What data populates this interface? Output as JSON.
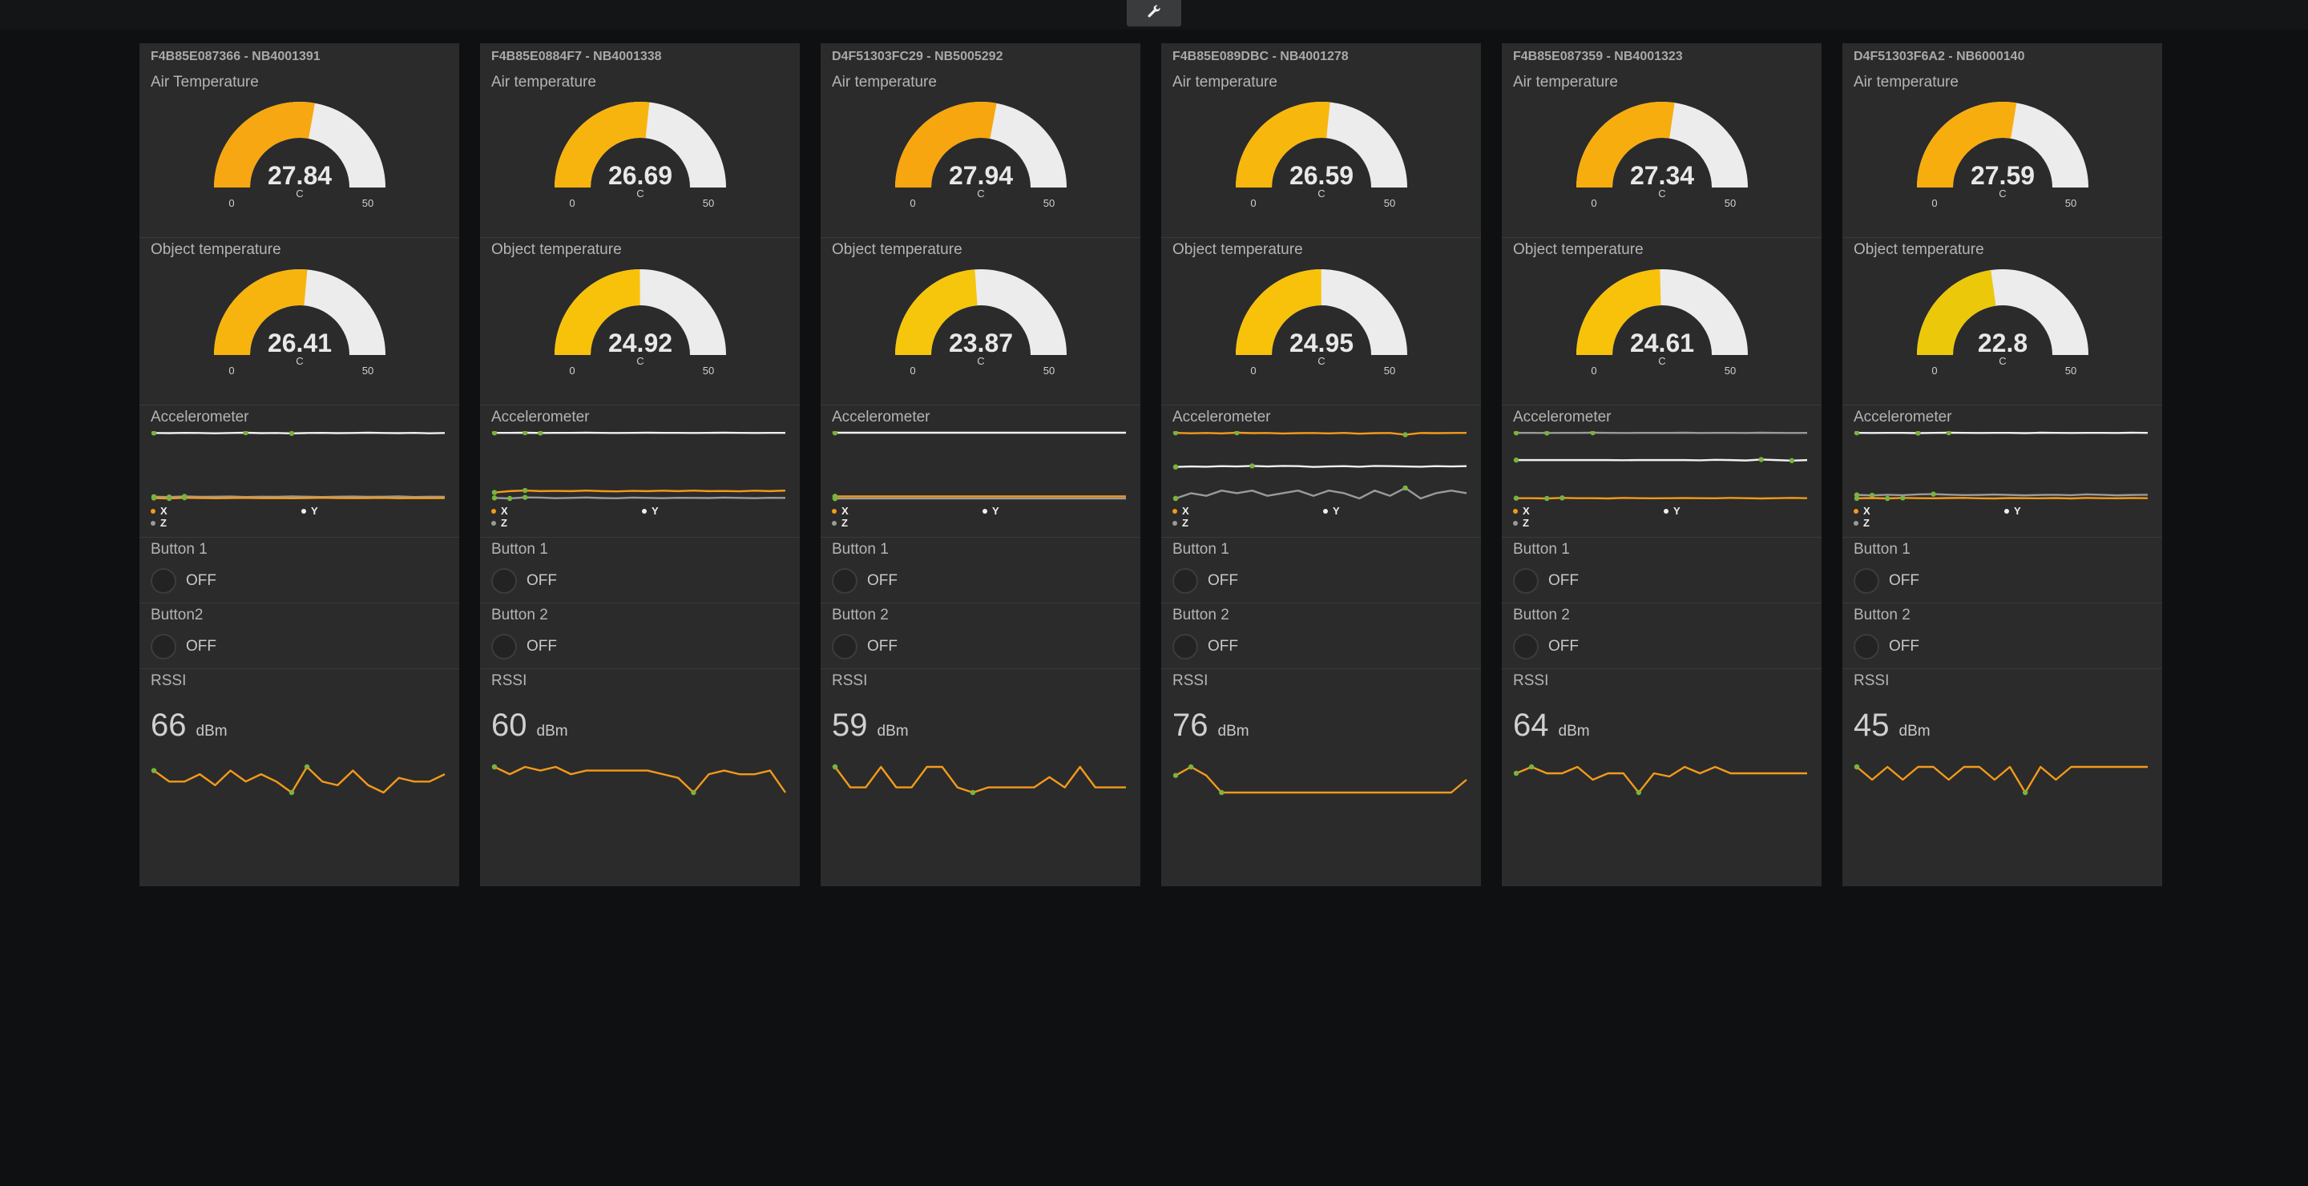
{
  "colors": {
    "accent": "#f5a623",
    "gauge_track": "#ececec",
    "gauge_text": "#e8e8e8",
    "spark_orange": "#f39a1a",
    "spark_white": "#f0f0f0",
    "spark_grey": "#9a9a9a",
    "spark_marker": "#79b33f",
    "pane_bg": "#2b2b2b",
    "page_bg": "#0f1012"
  },
  "toolbar": {
    "icon": "wrench-icon"
  },
  "panes": [
    {
      "title": "F4B85E087366 - NB4001391",
      "air": {
        "label": "Air Temperature",
        "value": "27.84",
        "unit": "C",
        "min": "0",
        "max": "50",
        "color": "#f7a711"
      },
      "obj": {
        "label": "Object temperature",
        "value": "26.41",
        "unit": "C",
        "min": "0",
        "max": "50",
        "color": "#f8b40e"
      },
      "accel": {
        "label": "Accelerometer",
        "x_label": "X",
        "y_label": "Y",
        "z_label": "Z",
        "series": {
          "y": [
            2,
            2.1,
            1.9,
            2,
            2.2,
            2,
            1.8,
            2.1,
            2,
            2.3,
            2,
            1.9,
            2.1,
            2,
            1.8,
            2,
            2.1,
            1.9,
            2.2,
            2
          ],
          "x": [
            50,
            50.3,
            49.8,
            50,
            50.2,
            50,
            49.9,
            50.1,
            50,
            50.2,
            50,
            49.8,
            50,
            50.1,
            50,
            49.9,
            50.2,
            50,
            50.1,
            50
          ],
          "z": [
            49,
            49.2,
            48.8,
            49.1,
            49,
            48.9,
            49.2,
            49,
            49.1,
            48.8,
            49,
            49.2,
            49,
            48.9,
            49.1,
            49,
            48.8,
            49.2,
            49,
            49.1
          ]
        }
      },
      "button1": {
        "label": "Button 1",
        "state": "OFF"
      },
      "button2": {
        "label": "Button2",
        "state": "OFF"
      },
      "rssi": {
        "label": "RSSI",
        "value": "66",
        "unit": "dBm",
        "series": [
          66,
          69,
          69,
          67,
          70,
          66,
          69,
          67,
          69,
          72,
          65,
          69,
          70,
          66,
          70,
          72,
          68,
          69,
          69,
          67
        ]
      }
    },
    {
      "title": "F4B85E0884F7 - NB4001338",
      "air": {
        "label": "Air temperature",
        "value": "26.69",
        "unit": "C",
        "min": "0",
        "max": "50",
        "color": "#f8b40e"
      },
      "obj": {
        "label": "Object temperature",
        "value": "24.92",
        "unit": "C",
        "min": "0",
        "max": "50",
        "color": "#f8c20b"
      },
      "accel": {
        "label": "Accelerometer",
        "x_label": "X",
        "y_label": "Y",
        "z_label": "Z",
        "series": {
          "y": [
            2,
            2,
            1.9,
            2.1,
            2,
            2,
            1.9,
            2,
            2.1,
            2,
            1.9,
            2,
            2,
            2.1,
            2,
            1.9,
            2,
            2.1,
            2,
            2
          ],
          "x": [
            46,
            45,
            44.5,
            45,
            44.8,
            45,
            44.6,
            45,
            45.2,
            44.8,
            45,
            44.7,
            45,
            44.6,
            45,
            44.9,
            45.1,
            44.7,
            45,
            44.6
          ],
          "z": [
            50,
            50.4,
            49.6,
            49.8,
            50.2,
            50,
            49.7,
            50.1,
            50.3,
            49.8,
            50,
            50.2,
            49.9,
            50,
            50.1,
            49.8,
            50,
            50.2,
            49.9,
            50
          ]
        }
      },
      "button1": {
        "label": "Button 1",
        "state": "OFF"
      },
      "button2": {
        "label": "Button 2",
        "state": "OFF"
      },
      "rssi": {
        "label": "RSSI",
        "value": "60",
        "unit": "dBm",
        "series": [
          63,
          65,
          63,
          64,
          63,
          65,
          64,
          64,
          64,
          64,
          64,
          65,
          66,
          70,
          65,
          64,
          65,
          65,
          64,
          70
        ]
      }
    },
    {
      "title": "D4F51303FC29 - NB5005292",
      "air": {
        "label": "Air temperature",
        "value": "27.94",
        "unit": "C",
        "min": "0",
        "max": "50",
        "color": "#f7a60f"
      },
      "obj": {
        "label": "Object temperature",
        "value": "23.87",
        "unit": "C",
        "min": "0",
        "max": "50",
        "color": "#f5c60b"
      },
      "accel": {
        "label": "Accelerometer",
        "x_label": "X",
        "y_label": "Y",
        "z_label": "Z",
        "series": {
          "y": [
            2,
            2,
            2,
            2,
            2,
            2,
            2,
            2,
            2,
            2,
            2,
            2,
            2,
            2,
            2,
            2,
            2,
            2,
            2,
            2
          ],
          "x": [
            49,
            49,
            49,
            49,
            49,
            49,
            49,
            49,
            49,
            49,
            49,
            49,
            49,
            49,
            49,
            49,
            49,
            49,
            49,
            49
          ],
          "z": [
            50.5,
            50.5,
            50.5,
            50.5,
            50.5,
            50.5,
            50.5,
            50.5,
            50.5,
            50.5,
            50.5,
            50.5,
            50.5,
            50.5,
            50.5,
            50.5,
            50.5,
            50.5,
            50.5,
            50.5
          ]
        }
      },
      "button1": {
        "label": "Button 1",
        "state": "OFF"
      },
      "button2": {
        "label": "Button 2",
        "state": "OFF"
      },
      "rssi": {
        "label": "RSSI",
        "value": "59",
        "unit": "dBm",
        "series": [
          58,
          62,
          62,
          58,
          62,
          62,
          58,
          58,
          62,
          63,
          62,
          62,
          62,
          62,
          60,
          62,
          58,
          62,
          62,
          62
        ]
      }
    },
    {
      "title": "F4B85E089DBC - NB4001278",
      "air": {
        "label": "Air temperature",
        "value": "26.59",
        "unit": "C",
        "min": "0",
        "max": "50",
        "color": "#f8b70d"
      },
      "obj": {
        "label": "Object temperature",
        "value": "24.95",
        "unit": "C",
        "min": "0",
        "max": "50",
        "color": "#f8c20b"
      },
      "accel": {
        "label": "Accelerometer",
        "x_label": "X",
        "y_label": "Y",
        "z_label": "Z",
        "series": {
          "x": [
            2,
            2.3,
            2.1,
            2.4,
            1.9,
            2.2,
            2.1,
            2.5,
            2.2,
            2.1,
            2.4,
            2,
            2.6,
            2.2,
            2.1,
            3.4,
            2.1,
            2.2,
            2.1,
            2
          ],
          "y": [
            28,
            27.6,
            27.8,
            27.4,
            27.6,
            27.2,
            27.6,
            27.2,
            27.4,
            28,
            27.6,
            27.4,
            27.8,
            27.2,
            27.4,
            27.6,
            27.8,
            27.4,
            27.6,
            27.4
          ],
          "z": [
            52,
            48,
            50,
            46,
            48,
            46,
            50,
            48,
            46,
            50,
            46,
            48,
            52,
            46,
            50,
            44,
            52,
            48,
            46,
            48
          ]
        }
      },
      "button1": {
        "label": "Button 1",
        "state": "OFF"
      },
      "button2": {
        "label": "Button 2",
        "state": "OFF"
      },
      "rssi": {
        "label": "RSSI",
        "value": "76",
        "unit": "dBm",
        "series": [
          68,
          64,
          68,
          76,
          76,
          76,
          76,
          76,
          76,
          76,
          76,
          76,
          76,
          76,
          76,
          76,
          76,
          76,
          76,
          70
        ]
      }
    },
    {
      "title": "F4B85E087359 - NB4001323",
      "air": {
        "label": "Air temperature",
        "value": "27.34",
        "unit": "C",
        "min": "0",
        "max": "50",
        "color": "#f8ad0f"
      },
      "obj": {
        "label": "Object temperature",
        "value": "24.61",
        "unit": "C",
        "min": "0",
        "max": "50",
        "color": "#f8c20b"
      },
      "accel": {
        "label": "Accelerometer",
        "x_label": "X",
        "y_label": "Y",
        "z_label": "Z",
        "series": {
          "z": [
            2,
            2,
            2.1,
            2,
            2,
            1.9,
            2,
            2.1,
            2,
            2,
            2,
            1.9,
            2.1,
            2,
            2,
            2.1,
            1.9,
            2,
            2.1,
            2
          ],
          "y": [
            22,
            22,
            22,
            22,
            22,
            22,
            22,
            22.1,
            22,
            22,
            22,
            22,
            22.2,
            21.8,
            22,
            22.3,
            21.6,
            22,
            22.4,
            22
          ],
          "x": [
            50,
            50,
            50.2,
            49.8,
            50,
            50,
            50.2,
            49.8,
            50,
            50.1,
            50,
            49.9,
            50,
            50.1,
            49.8,
            50,
            50.2,
            50,
            49.8,
            50
          ]
        }
      },
      "button1": {
        "label": "Button 1",
        "state": "OFF"
      },
      "button2": {
        "label": "Button 2",
        "state": "OFF"
      },
      "rssi": {
        "label": "RSSI",
        "value": "64",
        "unit": "dBm",
        "series": [
          62,
          60,
          62,
          62,
          60,
          64,
          62,
          62,
          68,
          62,
          63,
          60,
          62,
          60,
          62,
          62,
          62,
          62,
          62,
          62
        ]
      }
    },
    {
      "title": "D4F51303F6A2 - NB6000140",
      "air": {
        "label": "Air temperature",
        "value": "27.59",
        "unit": "C",
        "min": "0",
        "max": "50",
        "color": "#f8ad0f"
      },
      "obj": {
        "label": "Object temperature",
        "value": "22.8",
        "unit": "C",
        "min": "0",
        "max": "50",
        "color": "#ecc80b"
      },
      "accel": {
        "label": "Accelerometer",
        "x_label": "X",
        "y_label": "Y",
        "z_label": "Z",
        "series": {
          "y": [
            2,
            2.1,
            2,
            2,
            2.2,
            2,
            1.9,
            2,
            2.1,
            2,
            2,
            2.2,
            1.9,
            2,
            2.1,
            2,
            2,
            2.1,
            1.9,
            2
          ],
          "z": [
            48,
            48.3,
            47.9,
            48.2,
            47.6,
            47.4,
            47.8,
            48.1,
            48,
            47.7,
            48,
            48.3,
            48,
            47.9,
            48.2,
            47.6,
            47.9,
            48.3,
            48,
            47.9
          ],
          "x": [
            50.5,
            50.3,
            50.6,
            50.2,
            50.4,
            50.5,
            50.3,
            50.2,
            50.5,
            50.6,
            50.3,
            50.4,
            50.5,
            50.3,
            50.6,
            50.2,
            50.4,
            50.5,
            50.3,
            50.4
          ]
        }
      },
      "button1": {
        "label": "Button 1",
        "state": "OFF"
      },
      "button2": {
        "label": "Button 2",
        "state": "OFF"
      },
      "rssi": {
        "label": "RSSI",
        "value": "45",
        "unit": "dBm",
        "series": [
          45,
          46,
          45,
          46,
          45,
          45,
          46,
          45,
          45,
          46,
          45,
          47,
          45,
          46,
          45,
          45,
          45,
          45,
          45,
          45
        ]
      }
    }
  ]
}
